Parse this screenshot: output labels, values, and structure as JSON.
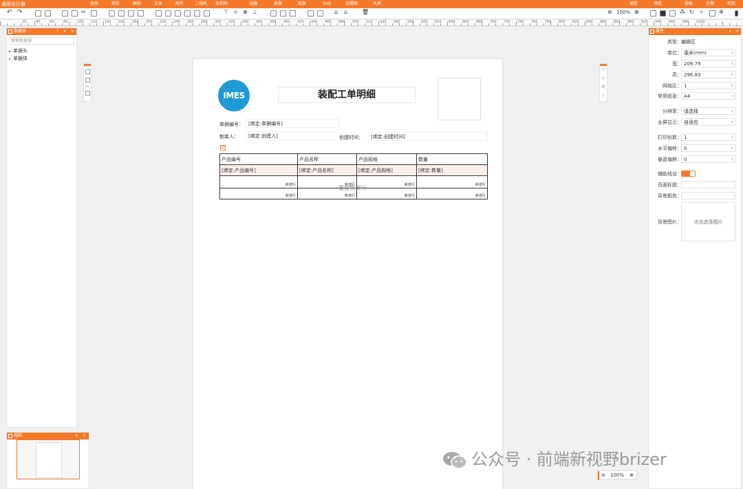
{
  "app": {
    "title": "通用设计器"
  },
  "menu": [
    "查找",
    "矩形",
    "图形",
    "文本",
    "图片",
    "二维码",
    "条形码",
    "容器",
    "表格",
    "图表",
    "SVG",
    "流程图",
    "大屏",
    "保存",
    "预览",
    "模板",
    "主题",
    "帮助"
  ],
  "toolbar": {
    "zoom": "100%"
  },
  "ruler": {
    "labels": [
      "20",
      "40",
      "60",
      "80",
      "100",
      "120",
      "140",
      "160",
      "180",
      "200",
      "220",
      "240",
      "260",
      "280",
      "300",
      "320",
      "340",
      "360",
      "380",
      "400",
      "420",
      "440",
      "460",
      "480",
      "500",
      "520",
      "540",
      "560",
      "580",
      "600",
      "620",
      "640",
      "660",
      "680",
      "700",
      "720",
      "740",
      "760",
      "780",
      "800",
      "820",
      "840",
      "860",
      "880",
      "900",
      "920",
      "940",
      "960",
      "980",
      "1000"
    ]
  },
  "datasource": {
    "title": "数据源",
    "search_placeholder": "搜索数据源",
    "items": [
      "单据头",
      "单据体"
    ]
  },
  "document": {
    "logo_text": "IMES",
    "title": "装配工单明细",
    "fields": [
      {
        "label": "单据编号：",
        "value": "[绑定:单据编号]"
      },
      {
        "label": "制单人：",
        "value": "[绑定:创建人]"
      },
      {
        "label": "创建时间：",
        "value": "[绑定:创建时间]"
      }
    ],
    "table": {
      "headers": [
        "产品编号",
        "产品名称",
        "产品规格",
        "数量"
      ],
      "bind_row": [
        "[绑定:产品编号]",
        "[绑定:产品名称]",
        "[绑定:产品规格]",
        "[绑定:数量]"
      ],
      "row_note": "新增行",
      "repeat_text": "重复数据行"
    }
  },
  "thumbnail": {
    "title": "视图"
  },
  "zoom_footer": "100%",
  "properties": {
    "title": "属性",
    "rows": [
      {
        "label": "类型：",
        "value": "编辑区",
        "plain": true
      },
      {
        "label": "单位：",
        "value": "毫米(mm)",
        "arrow": "∨"
      },
      {
        "label": "宽：",
        "value": "209.79",
        "arrow": "⇕"
      },
      {
        "label": "高：",
        "value": "296.83",
        "arrow": "⇕"
      },
      {
        "label": "网格区：",
        "value": "1",
        "arrow": "⇕"
      },
      {
        "label": "常用纸张：",
        "value": "A4",
        "arrow": "∨"
      },
      {
        "label": "分辨率：",
        "value": "请选择",
        "arrow": "∨"
      },
      {
        "label": "全屏显示：",
        "value": "自适应",
        "arrow": "∨"
      },
      {
        "label": "打印份数：",
        "value": "1",
        "arrow": "⇕"
      },
      {
        "label": "水平偏移：",
        "value": "0",
        "arrow": "⇕"
      },
      {
        "label": "垂直偏移：",
        "value": "0",
        "arrow": "⇕"
      }
    ],
    "toggle_label": "辅助线设：",
    "header_label": "页面标题：",
    "bgcolor_label": "背景颜色：",
    "bgimg_label": "背景图片：",
    "bgimg_text": "点击选择图片"
  },
  "watermark": "公众号 · 前端新视野brizer"
}
